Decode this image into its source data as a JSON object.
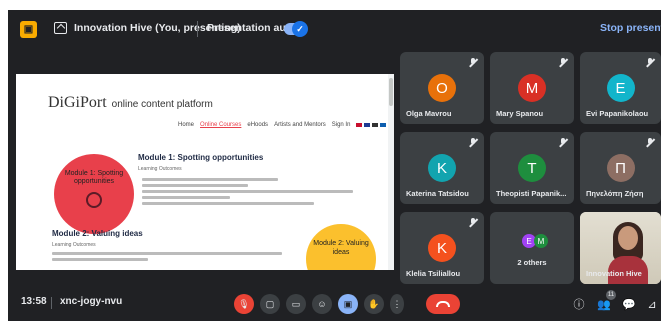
{
  "topbar": {
    "app_icon": "slides-icon",
    "presenting_label": "Innovation Hive (You, presenting)",
    "audio_label": "Presentation audio",
    "audio_enabled": true,
    "stop_label": "Stop presenting"
  },
  "slide": {
    "logo_text": "DiGiPort",
    "logo_tag": "online content platform",
    "nav": [
      "Home",
      "Online Courses",
      "eHoods",
      "Artists and Mentors",
      "Sign In"
    ],
    "nav_active_index": 1,
    "module1_title": "Module 1: Spotting opportunities",
    "module1_circle": "Module 1: Spotting opportunities",
    "learning_label": "Learning Outcomes",
    "module2_title": "Module 2: Valuing ideas",
    "module2_circle": "Module 2: Valuing ideas",
    "colors": {
      "red_circle": "#e8404b",
      "yellow_circle": "#fbc02d"
    }
  },
  "participants": [
    {
      "name": "Olga Mavrou",
      "initial": "O",
      "color": "#e8710a",
      "muted": true
    },
    {
      "name": "Mary Spanou",
      "initial": "M",
      "color": "#d93025",
      "muted": true
    },
    {
      "name": "Evi Papanikolaou",
      "initial": "E",
      "color": "#12b5cb",
      "muted": true
    },
    {
      "name": "Katerina Tatsidou",
      "initial": "K",
      "color": "#12a4af",
      "muted": true
    },
    {
      "name": "Theopisti Papanik...",
      "initial": "T",
      "color": "#1e8e3e",
      "muted": true
    },
    {
      "name": "Πηνελόπη Ζήση",
      "initial": "Π",
      "color": "#8d6e63",
      "muted": true
    },
    {
      "name": "Klelia Tsiliallou",
      "initial": "K",
      "color": "#f4511e",
      "muted": true
    },
    {
      "name": "2 others",
      "initials": [
        "E",
        "M"
      ],
      "colors": [
        "#a142f4",
        "#1e8e3e"
      ]
    },
    {
      "name": "Innovation Hive",
      "video": true
    }
  ],
  "bottombar": {
    "time": "13:58",
    "meeting_code": "xnc-jogy-nvu",
    "participant_count": "11",
    "controls": [
      "mic-off-icon",
      "camera-icon",
      "captions-icon",
      "emoji-icon",
      "present-icon",
      "raise-hand-icon",
      "more-icon"
    ]
  }
}
